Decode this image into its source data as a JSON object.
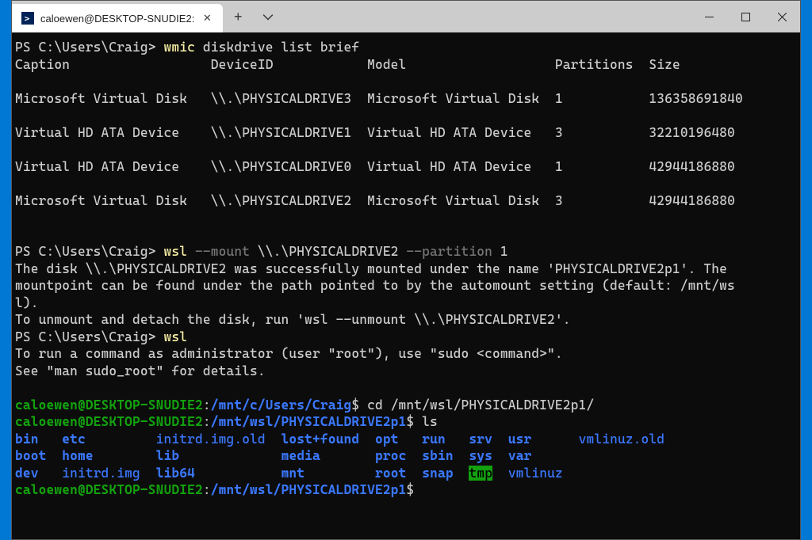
{
  "window": {
    "tab_title": "caloewen@DESKTOP-SNUDIE2:"
  },
  "ps": {
    "prompt": "PS C:\\Users\\Craig>",
    "cmd1_a": "wmic",
    "cmd1_b": " diskdrive list brief",
    "headers": {
      "caption": "Caption",
      "deviceid": "DeviceID",
      "model": "Model",
      "partitions": "Partitions",
      "size": "Size"
    },
    "rows": [
      {
        "caption": "Microsoft Virtual Disk",
        "deviceid": "\\\\.\\PHYSICALDRIVE3",
        "model": "Microsoft Virtual Disk",
        "partitions": "1",
        "size": "136358691840"
      },
      {
        "caption": "Virtual HD ATA Device",
        "deviceid": "\\\\.\\PHYSICALDRIVE1",
        "model": "Virtual HD ATA Device",
        "partitions": "3",
        "size": "32210196480"
      },
      {
        "caption": "Virtual HD ATA Device",
        "deviceid": "\\\\.\\PHYSICALDRIVE0",
        "model": "Virtual HD ATA Device",
        "partitions": "1",
        "size": "42944186880"
      },
      {
        "caption": "Microsoft Virtual Disk",
        "deviceid": "\\\\.\\PHYSICALDRIVE2",
        "model": "Microsoft Virtual Disk",
        "partitions": "3",
        "size": "42944186880"
      }
    ],
    "cmd2_a": "wsl",
    "cmd2_b": " --mount",
    "cmd2_c": " \\\\.\\PHYSICALDRIVE2",
    "cmd2_d": " --partition",
    "cmd2_e": " 1",
    "mount_msg1": "The disk \\\\.\\PHYSICALDRIVE2 was successfully mounted under the name 'PHYSICALDRIVE2p1'. The",
    "mount_msg2": "mountpoint can be found under the path pointed to by the automount setting (default: /mnt/ws",
    "mount_msg3": "l).",
    "mount_msg4": "To unmount and detach the disk, run 'wsl --unmount \\\\.\\PHYSICALDRIVE2'.",
    "cmd3_a": "wsl",
    "sudo_msg1": "To run a command as administrator (user \"root\"), use \"sudo <command>\".",
    "sudo_msg2": "See \"man sudo_root\" for details."
  },
  "bash": {
    "user": "caloewen@DESKTOP-SNUDIE2",
    "colon": ":",
    "path1": "/mnt/c/Users/Craig",
    "dollar": "$",
    "cmd_cd": " cd /mnt/wsl/PHYSICALDRIVE2p1/",
    "path2": "/mnt/wsl/PHYSICALDRIVE2p1",
    "cmd_ls": " ls",
    "ls": {
      "r1": {
        "c1": "bin",
        "c2": "etc",
        "c3": "initrd.img.old",
        "c4": "lost+found",
        "c5": "opt",
        "c6": "run",
        "c7": "srv",
        "c8": "usr",
        "c9": "vmlinuz.old"
      },
      "r2": {
        "c1": "boot",
        "c2": "home",
        "c3": "lib",
        "c4": "media",
        "c5": "proc",
        "c6": "sbin",
        "c7": "sys",
        "c8": "var"
      },
      "r3": {
        "c1": "dev",
        "c2": "initrd.img",
        "c3": "lib64",
        "c4": "mnt",
        "c5": "root",
        "c6": "snap",
        "c7": "tmp",
        "c8": "vmlinuz"
      }
    }
  }
}
